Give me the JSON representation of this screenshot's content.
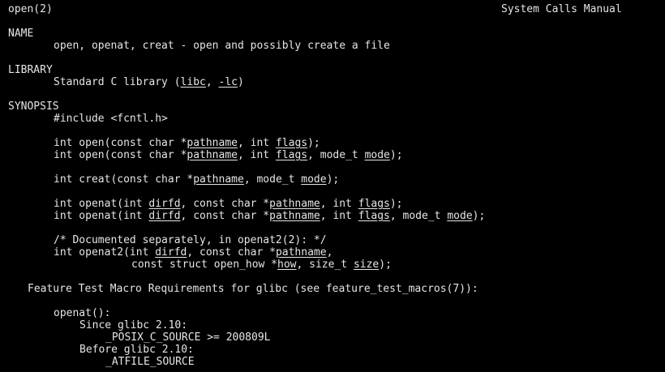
{
  "header": {
    "left": "open(2)",
    "right": "System Calls Manual"
  },
  "sections": {
    "name": {
      "heading": "NAME",
      "text": "open, openat, creat - open and possibly create a file"
    },
    "library": {
      "heading": "LIBRARY",
      "prefix": "Standard C library (",
      "lib1": "libc",
      "sep": ", ",
      "lib2": "-lc",
      "suffix": ")"
    },
    "synopsis": {
      "heading": "SYNOPSIS",
      "include": "#include <fcntl.h>",
      "open1": {
        "p1": "int open(const char *",
        "pathname": "pathname",
        "p2": ", int ",
        "flags": "flags",
        "p3": ");"
      },
      "open2": {
        "p1": "int open(const char *",
        "pathname": "pathname",
        "p2": ", int ",
        "flags": "flags",
        "p3": ", mode_t ",
        "mode": "mode",
        "p4": ");"
      },
      "creat": {
        "p1": "int creat(const char *",
        "pathname": "pathname",
        "p2": ", mode_t ",
        "mode": "mode",
        "p3": ");"
      },
      "openat1": {
        "p1": "int openat(int ",
        "dirfd": "dirfd",
        "p2": ", const char *",
        "pathname": "pathname",
        "p3": ", int ",
        "flags": "flags",
        "p4": ");"
      },
      "openat2": {
        "p1": "int openat(int ",
        "dirfd": "dirfd",
        "p2": ", const char *",
        "pathname": "pathname",
        "p3": ", int ",
        "flags": "flags",
        "p4": ", mode_t ",
        "mode": "mode",
        "p5": ");"
      },
      "comment": "/* Documented separately, in openat2(2): */",
      "openat2_a": {
        "p1": "int openat2(int ",
        "dirfd": "dirfd",
        "p2": ", const char *",
        "pathname": "pathname",
        "p3": ","
      },
      "openat2_b": {
        "p1": "const struct open_how *",
        "how": "how",
        "p2": ", size_t ",
        "size": "size",
        "p3": ");"
      }
    },
    "ftm": {
      "heading": "Feature Test Macro Requirements for glibc (see feature_test_macros(7)):",
      "fn": "openat():",
      "since": "Since glibc 2.10:",
      "since_val": "_POSIX_C_SOURCE >= 200809L",
      "before": "Before glibc 2.10:",
      "before_val": "_ATFILE_SOURCE"
    }
  },
  "colors": {
    "background": "#000000",
    "foreground": "#e5e5e5"
  }
}
